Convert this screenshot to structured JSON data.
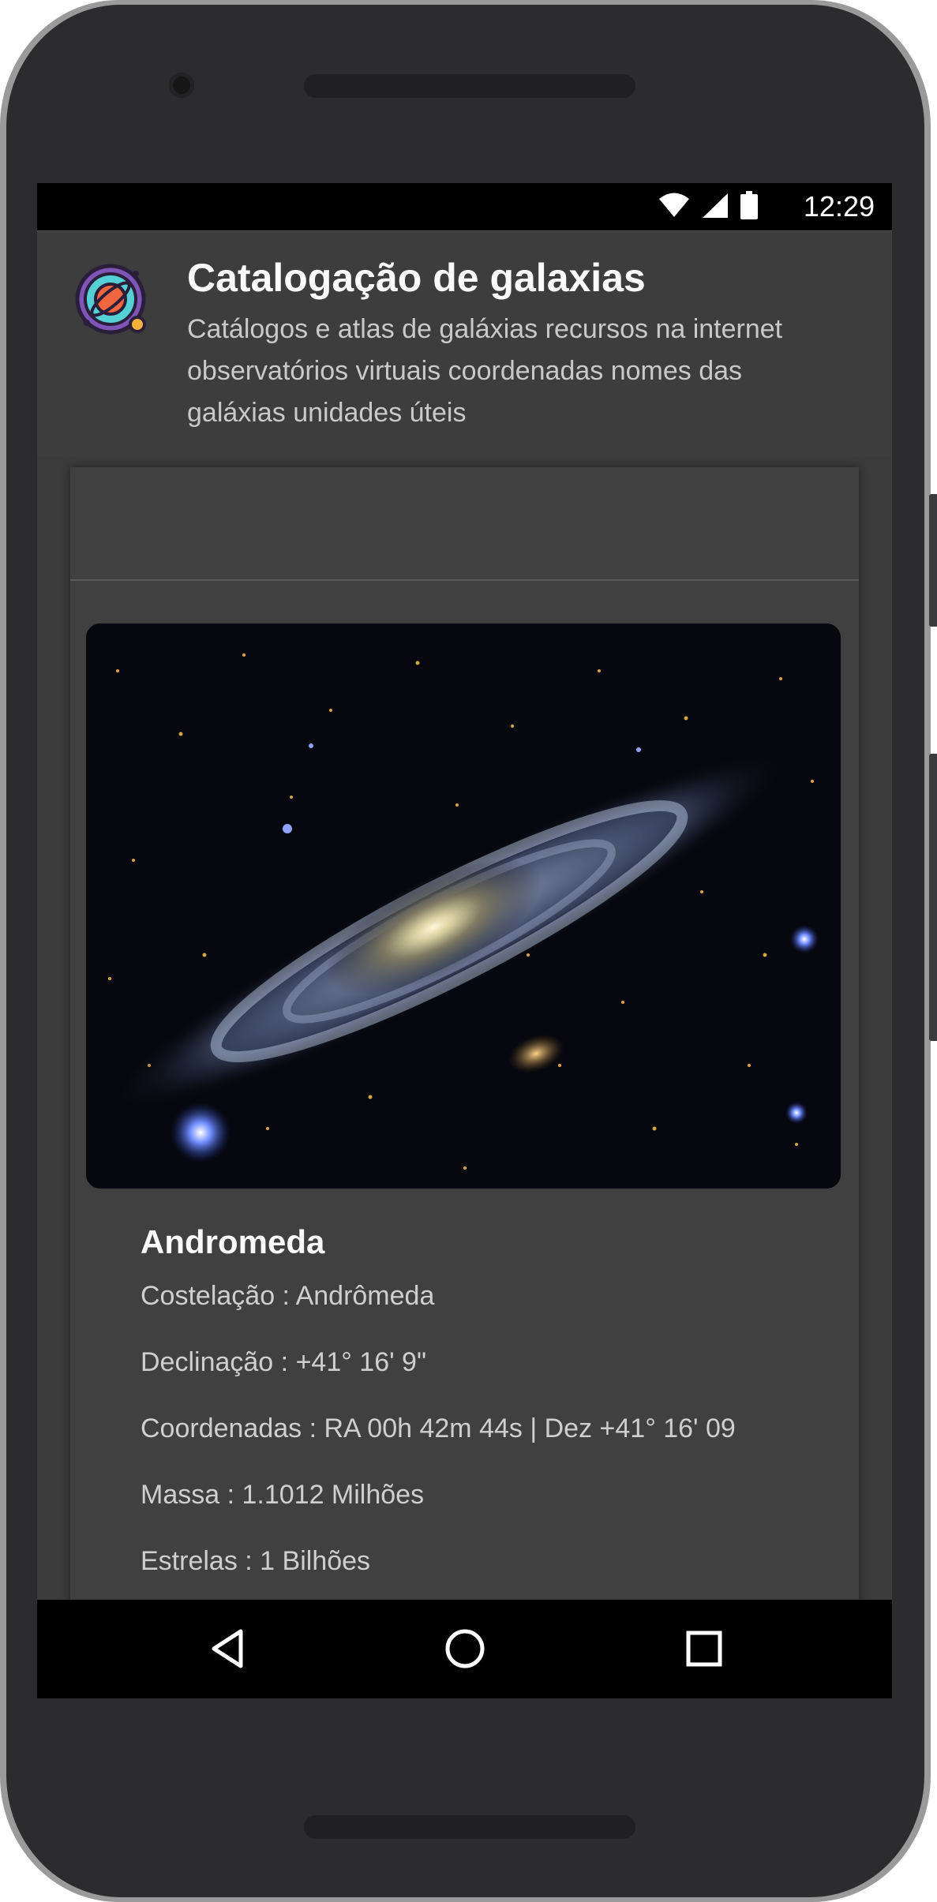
{
  "status_bar": {
    "time": "12:29",
    "icons": [
      "wifi-icon",
      "signal-icon",
      "battery-icon"
    ]
  },
  "header": {
    "app_icon": "planet-icon",
    "title": "Catalogação de galaxias",
    "subtitle": "Catálogos e atlas de galáxias recursos na internet observatórios virtuais coordenadas nomes das galáxias unidades úteis"
  },
  "galaxy": {
    "image": "galaxy-photo",
    "name": "Andromeda",
    "fields": [
      {
        "label": "Costelação",
        "value": "Andrômeda"
      },
      {
        "label": "Declinação",
        "value": "+41° 16' 9\""
      },
      {
        "label": "Coordenadas",
        "value": "RA 00h 42m 44s | Dez +41° 16' 09"
      },
      {
        "label": "Massa",
        "value": "1.1012 Milhões"
      },
      {
        "label": "Estrelas",
        "value": "1 Bilhões"
      }
    ]
  },
  "nav_bar": {
    "buttons": [
      "back-icon",
      "home-icon",
      "recent-apps-icon"
    ]
  },
  "colors": {
    "screen_background": "#3b3b3b",
    "card_background": "#404040",
    "title_text": "#fafafa",
    "body_text": "#cfcfcf"
  }
}
